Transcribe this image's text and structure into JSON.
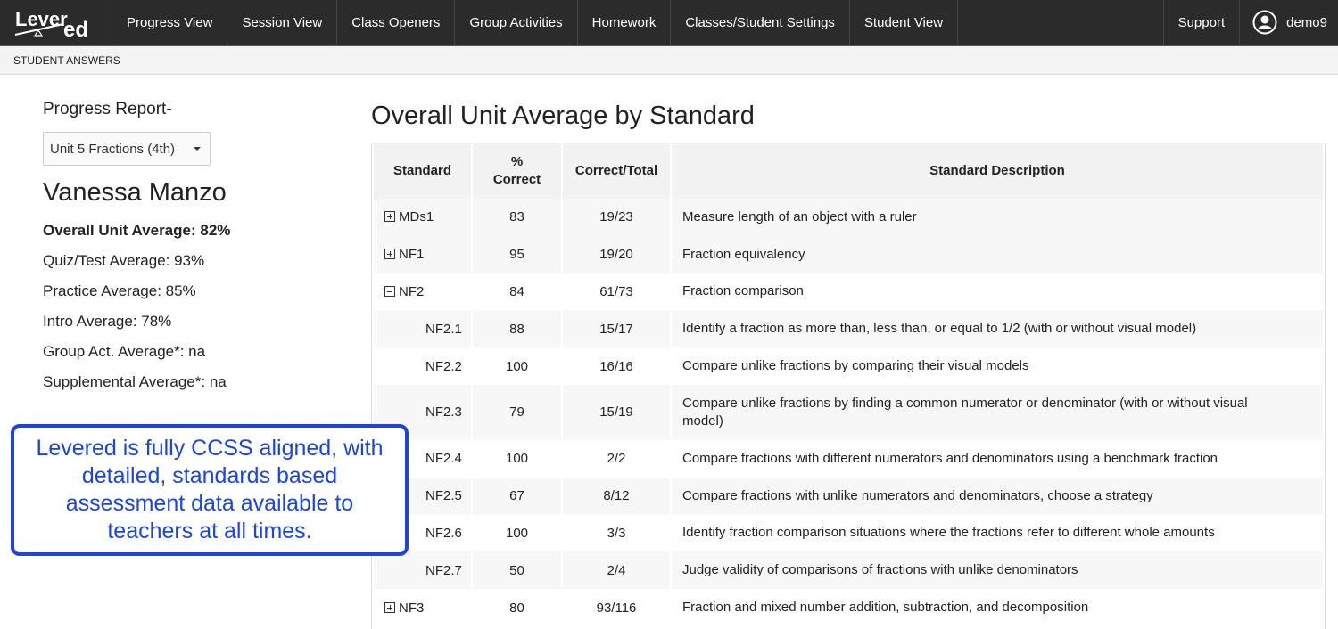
{
  "nav": {
    "logo_text": "Levered",
    "items": [
      "Progress View",
      "Session View",
      "Class Openers",
      "Group Activities",
      "Homework",
      "Classes/Student Settings",
      "Student View"
    ],
    "support": "Support",
    "username": "demo9"
  },
  "subheader": {
    "label": "STUDENT ANSWERS"
  },
  "left": {
    "report_label": "Progress Report-",
    "unit_select": "Unit 5 Fractions (4th)",
    "student_name": "Vanessa Manzo",
    "stats": [
      "Overall Unit Average: 82%",
      "Quiz/Test Average: 93%",
      "Practice Average: 85%",
      "Intro Average: 78%",
      "Group Act. Average*: na",
      "Supplemental Average*: na"
    ]
  },
  "callout": {
    "text": "Levered is fully CCSS aligned, with detailed, standards based assessment data available to teachers at all times."
  },
  "main": {
    "title": "Overall Unit Average by Standard",
    "headers": {
      "standard": "Standard",
      "percent_correct": "% Correct",
      "correct_total": "Correct/Total",
      "description": "Standard Description"
    },
    "rows": [
      {
        "code": "MDs1",
        "percent": "83",
        "ct": "19/23",
        "desc": "Measure length of an object with a ruler"
      },
      {
        "code": "NF1",
        "percent": "95",
        "ct": "19/20",
        "desc": "Fraction equivalency"
      },
      {
        "code": "NF2",
        "percent": "84",
        "ct": "61/73",
        "desc": "Fraction comparison"
      },
      {
        "code": "NF2.1",
        "percent": "88",
        "ct": "15/17",
        "desc": "Identify a fraction as more than, less than, or equal to 1/2 (with or without visual model)"
      },
      {
        "code": "NF2.2",
        "percent": "100",
        "ct": "16/16",
        "desc": "Compare unlike fractions by comparing their visual models"
      },
      {
        "code": "NF2.3",
        "percent": "79",
        "ct": "15/19",
        "desc": "Compare unlike fractions by finding a common numerator or denominator (with or without visual model)"
      },
      {
        "code": "NF2.4",
        "percent": "100",
        "ct": "2/2",
        "desc": "Compare fractions with different numerators and denominators using a benchmark fraction"
      },
      {
        "code": "NF2.5",
        "percent": "67",
        "ct": "8/12",
        "desc": "Compare fractions with unlike numerators and denominators, choose a strategy"
      },
      {
        "code": "NF2.6",
        "percent": "100",
        "ct": "3/3",
        "desc": "Identify fraction comparison situations where the fractions refer to different whole amounts"
      },
      {
        "code": "NF2.7",
        "percent": "50",
        "ct": "2/4",
        "desc": "Judge validity of comparisons of fractions with unlike denominators"
      },
      {
        "code": "NF3",
        "percent": "80",
        "ct": "93/116",
        "desc": "Fraction and mixed number addition, subtraction, and decomposition"
      }
    ]
  },
  "colors": {
    "navbar": "#2b2b2b",
    "callout_blue": "#1b46d6"
  }
}
